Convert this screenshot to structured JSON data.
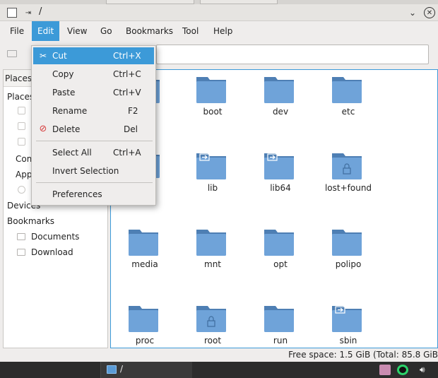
{
  "window": {
    "title": "/"
  },
  "menubar": [
    "File",
    "Edit",
    "View",
    "Go",
    "Bookmarks",
    "Tool",
    "Help"
  ],
  "edit_menu": {
    "items": [
      {
        "label": "Cut",
        "shortcut": "Ctrl+X",
        "icon": "scissors-icon"
      },
      {
        "label": "Copy",
        "shortcut": "Ctrl+C",
        "icon": "copy-icon"
      },
      {
        "label": "Paste",
        "shortcut": "Ctrl+V",
        "icon": "paste-icon"
      },
      {
        "label": "Rename",
        "shortcut": "F2",
        "icon": ""
      },
      {
        "label": "Delete",
        "shortcut": "Del",
        "icon": "delete-icon"
      },
      {
        "label": "Select All",
        "shortcut": "Ctrl+A",
        "icon": ""
      },
      {
        "label": "Invert Selection",
        "shortcut": "",
        "icon": ""
      },
      {
        "label": "Preferences",
        "shortcut": "",
        "icon": ""
      }
    ]
  },
  "sidebar": {
    "header": "Places",
    "places_label": "Places",
    "computer_label": "Com",
    "apps_label": "Appl",
    "devices_label": "Devices",
    "bookmarks_label": "Bookmarks",
    "bookmark_items": [
      "Documents",
      "Download"
    ]
  },
  "files": [
    {
      "name": "boot",
      "type": "folder"
    },
    {
      "name": "dev",
      "type": "folder"
    },
    {
      "name": "etc",
      "type": "folder"
    },
    {
      "name": "lib",
      "type": "link"
    },
    {
      "name": "lib64",
      "type": "link"
    },
    {
      "name": "lost+found",
      "type": "locked"
    },
    {
      "name": "media",
      "type": "folder"
    },
    {
      "name": "mnt",
      "type": "folder"
    },
    {
      "name": "opt",
      "type": "folder"
    },
    {
      "name": "polipo",
      "type": "folder"
    },
    {
      "name": "proc",
      "type": "folder"
    },
    {
      "name": "root",
      "type": "locked"
    },
    {
      "name": "run",
      "type": "folder"
    },
    {
      "name": "sbin",
      "type": "link"
    }
  ],
  "status": {
    "free_space": "Free space: 1.5 GiB (Total: 85.8 GiB"
  },
  "taskbar": {
    "task_label": "/"
  },
  "colors": {
    "accent": "#3c9ad8",
    "folder_body": "#6fa3d9",
    "folder_tab": "#4e7fb4"
  }
}
